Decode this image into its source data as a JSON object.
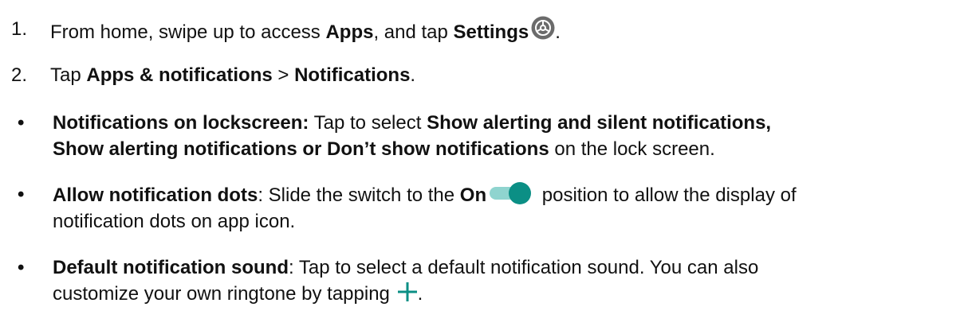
{
  "steps": [
    {
      "number": "1.",
      "part1": "From home, swipe up to access ",
      "bold1": "Apps",
      "part2": ", and tap ",
      "bold2": "Settings",
      "icon": "settings-gear-icon",
      "end": "."
    },
    {
      "number": "2.",
      "part1": "Tap ",
      "bold1": "Apps & notifications",
      "part2": " > ",
      "bold2": "Notifications",
      "end": "."
    }
  ],
  "bullets": [
    {
      "symbol": "•",
      "title": "Notifications on lockscreen:",
      "part1": " Tap to select ",
      "bold1": "Show alerting and silent notifications,",
      "bold2": "Show alerting notifications or Don’t show notifications",
      "part2": " on the lock screen."
    },
    {
      "symbol": "•",
      "title": "Allow notification dots",
      "part1": ": Slide the switch to the ",
      "bold1": "On",
      "icon": "toggle-on-icon",
      "part2": " position to allow the display of",
      "line2": "notification dots on app icon."
    },
    {
      "symbol": "•",
      "title": "Default notification sound",
      "part1": ": Tap to select a default notification sound. You can also",
      "line2": "customize your own ringtone by tapping ",
      "icon": "plus-icon",
      "end": "."
    }
  ],
  "colors": {
    "accent": "#0b8f85",
    "toggle_track": "#8fd4cf",
    "icon_dark": "#6b6b6b",
    "text": "#111111"
  }
}
